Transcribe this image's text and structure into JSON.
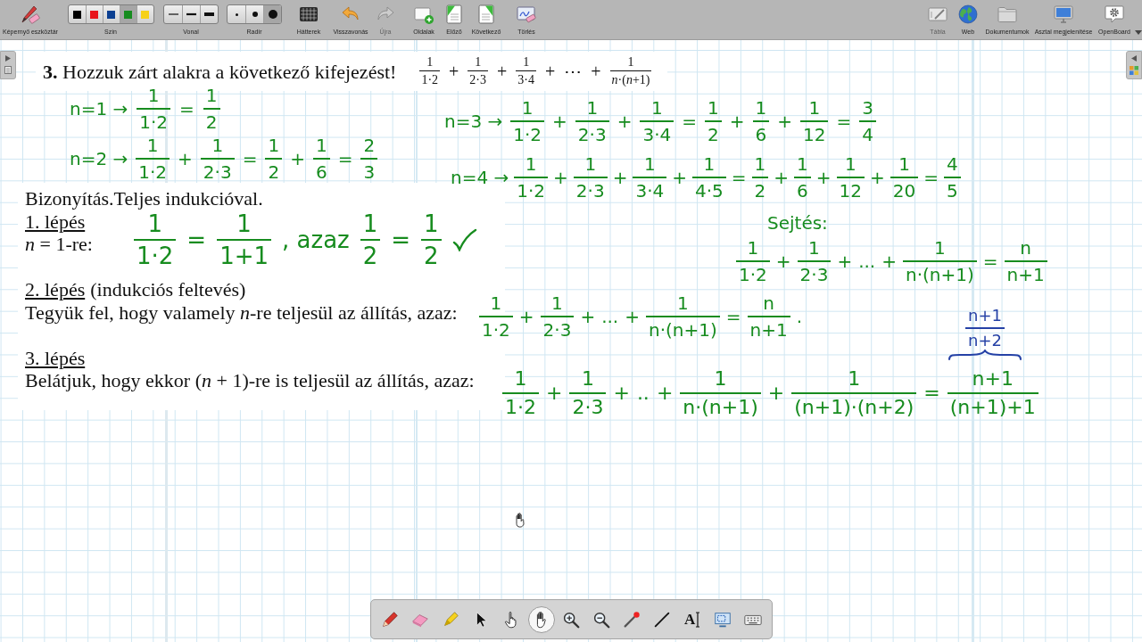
{
  "toolbar": {
    "left": [
      {
        "kind": "button",
        "label": "Képernyő eszköztár",
        "disabled": false
      },
      {
        "kind": "colors",
        "label": "Szín",
        "options": [
          {
            "color": "#000000",
            "selected": false
          },
          {
            "color": "#e8141b",
            "selected": false
          },
          {
            "color": "#0b3f91",
            "selected": false
          },
          {
            "color": "#178c1f",
            "selected": true
          },
          {
            "color": "#f7d117",
            "selected": false
          }
        ]
      },
      {
        "kind": "widths",
        "label": "Vonal",
        "options": [
          {
            "selected": false
          },
          {
            "selected": false
          },
          {
            "selected": false
          }
        ]
      },
      {
        "kind": "sizes",
        "label": "Radír",
        "options": [
          {
            "selected": false
          },
          {
            "selected": false
          },
          {
            "selected": true
          }
        ]
      },
      {
        "kind": "button",
        "label": "Hátterek",
        "disabled": false
      },
      {
        "kind": "button",
        "label": "Visszavonás",
        "disabled": false
      },
      {
        "kind": "button",
        "label": "Újra",
        "disabled": true
      },
      {
        "kind": "button",
        "label": "Oldalak",
        "disabled": false
      },
      {
        "kind": "button",
        "label": "Előző",
        "disabled": false
      },
      {
        "kind": "button",
        "label": "Következő",
        "disabled": false
      },
      {
        "kind": "button",
        "label": "Törlés",
        "disabled": false
      }
    ],
    "right": [
      {
        "label": "Tábla",
        "disabled": true
      },
      {
        "label": "Web",
        "disabled": false
      },
      {
        "label": "Dokumentumok",
        "disabled": false
      },
      {
        "label": "Asztal megjelenítése",
        "disabled": false
      },
      {
        "label": "OpenBoard",
        "disabled": false
      }
    ]
  },
  "task": {
    "text": "**3.** Hozzuk zárt alakra a következő kifejezést!",
    "formula": [
      {
        "kind": "frac",
        "num": "1",
        "den": "1·2"
      },
      {
        "kind": "text",
        "text": "+"
      },
      {
        "kind": "frac",
        "num": "1",
        "den": "2·3"
      },
      {
        "kind": "text",
        "text": "+"
      },
      {
        "kind": "frac",
        "num": "1",
        "den": "3·4"
      },
      {
        "kind": "text",
        "text": "+"
      },
      {
        "kind": "text",
        "text": "⋯"
      },
      {
        "kind": "text",
        "text": "+"
      },
      {
        "kind": "frac",
        "num": "1",
        "den": "*n*·(*n*+1)"
      }
    ]
  },
  "proof": {
    "title": "Bizonyítás.Teljes indukcióval.",
    "steps": [
      {
        "heading": "1. lépés",
        "text": "*n* = 1-re:"
      },
      {
        "heading": "2. lépés",
        "note": "(indukciós feltevés)",
        "text": "Tegyük fel, hogy valamely *n*-re teljesül az állítás, azaz:"
      },
      {
        "heading": "3. lépés",
        "text": "Belátjuk, hogy ekkor (*n* + 1)-re is teljesül az állítás, azaz:"
      }
    ]
  },
  "notes": [
    {
      "color": "#178c1f",
      "tokens": [
        {
          "kind": "text",
          "text": "n=1 →"
        },
        {
          "kind": "frac",
          "num": "1",
          "den": "1·2"
        },
        {
          "kind": "text",
          "text": "="
        },
        {
          "kind": "frac",
          "num": "1",
          "den": "2"
        }
      ]
    },
    {
      "color": "#178c1f",
      "tokens": [
        {
          "kind": "text",
          "text": "n=2 →"
        },
        {
          "kind": "frac",
          "num": "1",
          "den": "1·2"
        },
        {
          "kind": "text",
          "text": "+"
        },
        {
          "kind": "frac",
          "num": "1",
          "den": "2·3"
        },
        {
          "kind": "text",
          "text": "="
        },
        {
          "kind": "frac",
          "num": "1",
          "den": "2"
        },
        {
          "kind": "text",
          "text": "+"
        },
        {
          "kind": "frac",
          "num": "1",
          "den": "6"
        },
        {
          "kind": "text",
          "text": "="
        },
        {
          "kind": "frac",
          "num": "2",
          "den": "3"
        }
      ]
    },
    {
      "color": "#178c1f",
      "tokens": [
        {
          "kind": "text",
          "text": "n=3 →"
        },
        {
          "kind": "frac",
          "num": "1",
          "den": "1·2"
        },
        {
          "kind": "text",
          "text": "+"
        },
        {
          "kind": "frac",
          "num": "1",
          "den": "2·3"
        },
        {
          "kind": "text",
          "text": "+"
        },
        {
          "kind": "frac",
          "num": "1",
          "den": "3·4"
        },
        {
          "kind": "text",
          "text": "="
        },
        {
          "kind": "frac",
          "num": "1",
          "den": "2"
        },
        {
          "kind": "text",
          "text": "+"
        },
        {
          "kind": "frac",
          "num": "1",
          "den": "6"
        },
        {
          "kind": "text",
          "text": "+"
        },
        {
          "kind": "frac",
          "num": "1",
          "den": "12"
        },
        {
          "kind": "text",
          "text": "="
        },
        {
          "kind": "frac",
          "num": "3",
          "den": "4"
        }
      ]
    },
    {
      "color": "#178c1f",
      "tokens": [
        {
          "kind": "text",
          "text": "n=4 →"
        },
        {
          "kind": "frac",
          "num": "1",
          "den": "1·2"
        },
        {
          "kind": "text",
          "text": "+"
        },
        {
          "kind": "frac",
          "num": "1",
          "den": "2·3"
        },
        {
          "kind": "text",
          "text": "+"
        },
        {
          "kind": "frac",
          "num": "1",
          "den": "3·4"
        },
        {
          "kind": "text",
          "text": "+"
        },
        {
          "kind": "frac",
          "num": "1",
          "den": "4·5"
        },
        {
          "kind": "text",
          "text": "="
        },
        {
          "kind": "frac",
          "num": "1",
          "den": "2"
        },
        {
          "kind": "text",
          "text": "+"
        },
        {
          "kind": "frac",
          "num": "1",
          "den": "6"
        },
        {
          "kind": "text",
          "text": "+"
        },
        {
          "kind": "frac",
          "num": "1",
          "den": "12"
        },
        {
          "kind": "text",
          "text": "+"
        },
        {
          "kind": "frac",
          "num": "1",
          "den": "20"
        },
        {
          "kind": "text",
          "text": "="
        },
        {
          "kind": "frac",
          "num": "4",
          "den": "5"
        }
      ]
    },
    {
      "color": "#178c1f",
      "tick": true,
      "tokens": [
        {
          "kind": "frac",
          "num": "1",
          "den": "1·2"
        },
        {
          "kind": "text",
          "text": "="
        },
        {
          "kind": "frac",
          "num": "1",
          "den": "1+1"
        },
        {
          "kind": "text",
          "text": ", azaz"
        },
        {
          "kind": "frac",
          "num": "1",
          "den": "2"
        },
        {
          "kind": "text",
          "text": "="
        },
        {
          "kind": "frac",
          "num": "1",
          "den": "2"
        }
      ]
    },
    {
      "color": "#178c1f",
      "tokens": [
        {
          "kind": "text",
          "text": "Sejtés:"
        }
      ]
    },
    {
      "color": "#178c1f",
      "tokens": [
        {
          "kind": "frac",
          "num": "1",
          "den": "1·2"
        },
        {
          "kind": "text",
          "text": "+"
        },
        {
          "kind": "frac",
          "num": "1",
          "den": "2·3"
        },
        {
          "kind": "text",
          "text": "+"
        },
        {
          "kind": "text",
          "text": "..."
        },
        {
          "kind": "text",
          "text": "+"
        },
        {
          "kind": "frac",
          "num": "1",
          "den": "n·(n+1)"
        },
        {
          "kind": "text",
          "text": "="
        },
        {
          "kind": "frac",
          "num": "n",
          "den": "n+1"
        }
      ]
    },
    {
      "color": "#178c1f",
      "tokens": [
        {
          "kind": "frac",
          "num": "1",
          "den": "1·2"
        },
        {
          "kind": "text",
          "text": "+"
        },
        {
          "kind": "frac",
          "num": "1",
          "den": "2·3"
        },
        {
          "kind": "text",
          "text": "+"
        },
        {
          "kind": "text",
          "text": "..."
        },
        {
          "kind": "text",
          "text": "+"
        },
        {
          "kind": "frac",
          "num": "1",
          "den": "n·(n+1)"
        },
        {
          "kind": "text",
          "text": "="
        },
        {
          "kind": "frac",
          "num": "n",
          "den": "n+1"
        },
        {
          "kind": "text",
          "text": "."
        }
      ]
    },
    {
      "color": "#2541a6",
      "brace": true,
      "tokens": [
        {
          "kind": "frac",
          "num": "n+1",
          "den": "n+2"
        }
      ]
    },
    {
      "color": "#178c1f",
      "tokens": [
        {
          "kind": "frac",
          "num": "1",
          "den": "1·2"
        },
        {
          "kind": "text",
          "text": "+"
        },
        {
          "kind": "frac",
          "num": "1",
          "den": "2·3"
        },
        {
          "kind": "text",
          "text": "+"
        },
        {
          "kind": "text",
          "text": ".."
        },
        {
          "kind": "text",
          "text": "+"
        },
        {
          "kind": "frac",
          "num": "1",
          "den": "n·(n+1)"
        },
        {
          "kind": "text",
          "text": "+"
        },
        {
          "kind": "frac",
          "num": "1",
          "den": "(n+1)·(n+2)"
        },
        {
          "kind": "text",
          "text": "="
        },
        {
          "kind": "frac",
          "num": "n+1",
          "den": "(n+1)+1"
        }
      ]
    }
  ],
  "tools": [
    {
      "selected": false
    },
    {
      "selected": false
    },
    {
      "selected": false
    },
    {
      "selected": false
    },
    {
      "selected": false
    },
    {
      "selected": true
    },
    {
      "selected": false
    },
    {
      "selected": false
    },
    {
      "selected": false
    },
    {
      "selected": false
    },
    {
      "glyph": "A",
      "selected": false
    },
    {
      "selected": false
    },
    {
      "selected": false
    }
  ]
}
